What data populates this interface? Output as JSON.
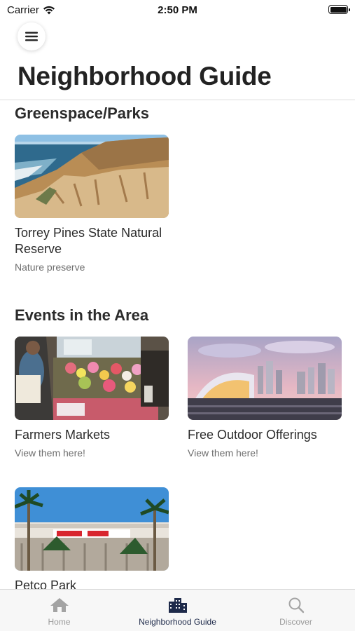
{
  "status_bar": {
    "carrier": "Carrier",
    "time": "2:50 PM"
  },
  "header": {
    "title": "Neighborhood Guide"
  },
  "sections": [
    {
      "title": "Greenspace/Parks",
      "cards": [
        {
          "title": "Torrey Pines State Natural Reserve",
          "subtitle": "Nature preserve"
        }
      ]
    },
    {
      "title": "Events in the Area",
      "cards": [
        {
          "title": "Farmers Markets",
          "subtitle": "View them here!"
        },
        {
          "title": "Free Outdoor Offerings",
          "subtitle": "View them here!"
        },
        {
          "title": "Petco Park",
          "subtitle": ""
        }
      ]
    }
  ],
  "tab_bar": {
    "tabs": [
      {
        "label": "Home",
        "icon": "home-icon",
        "active": false
      },
      {
        "label": "Neighborhood Guide",
        "icon": "buildings-icon",
        "active": true
      },
      {
        "label": "Discover",
        "icon": "search-icon",
        "active": false
      }
    ]
  },
  "colors": {
    "active_tab": "#1e2a4a",
    "inactive_tab": "#9a9a9a"
  }
}
